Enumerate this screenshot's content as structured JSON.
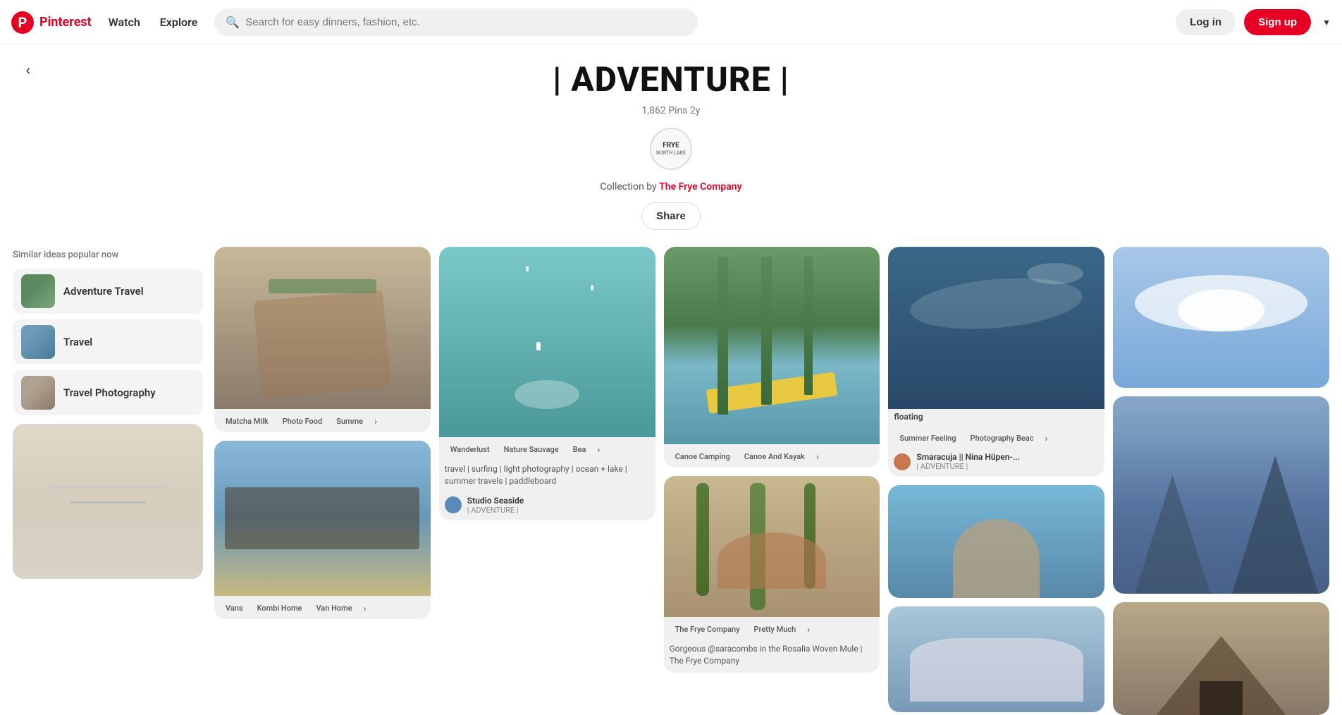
{
  "header": {
    "logo_text": "Pinterest",
    "nav": [
      {
        "id": "watch",
        "label": "Watch"
      },
      {
        "id": "explore",
        "label": "Explore"
      }
    ],
    "search_placeholder": "Search for easy dinners, fashion, etc.",
    "login_label": "Log in",
    "signup_label": "Sign up"
  },
  "board": {
    "title": "| ADVENTURE |",
    "pins_count": "1,862 Pins",
    "age": "2y",
    "frye_line1": "FRYE",
    "frye_line2": "NORTH LAKE",
    "collection_prefix": "Collection by ",
    "collection_owner": "The Frye Company",
    "share_label": "Share"
  },
  "sidebar": {
    "heading": "Similar ideas popular now",
    "items": [
      {
        "id": "adventure-travel",
        "label": "Adventure Travel"
      },
      {
        "id": "travel",
        "label": "Travel"
      },
      {
        "id": "travel-photography",
        "label": "Travel Photography"
      }
    ]
  },
  "pins": [
    {
      "id": "pin-food",
      "bg": "pin-bg-food",
      "tags": [
        "Matcha Milk",
        "Photo Food",
        "Summe"
      ],
      "has_more": true
    },
    {
      "id": "pin-van",
      "bg": "pin-bg-van",
      "tags": [
        "Vans",
        "Kombi Home",
        "Van Home"
      ],
      "has_more": true
    },
    {
      "id": "pin-water",
      "bg": "pin-bg-water",
      "tags": [
        "Wanderlust",
        "Nature Sauvage",
        "Bea"
      ],
      "has_more": true,
      "desc": "travel | surfing | light photography | ocean + lake | summer travels | paddleboard",
      "user_name": "Studio Seaside",
      "user_caption": "| ADVENTURE |"
    },
    {
      "id": "pin-canoe",
      "bg": "pin-bg-forest",
      "tags": [
        "Canoe Camping",
        "Canoe And Kayak"
      ],
      "has_more": true
    },
    {
      "id": "pin-cactus",
      "bg": "pin-bg-cactus",
      "tags": [
        "The Frye Company",
        "Pretty Much"
      ],
      "has_more": true,
      "desc": "Gorgeous @saracombs in the Rosalia Woven Mule | The Frye Company"
    },
    {
      "id": "pin-sea",
      "bg": "pin-bg-sea",
      "tags": [
        "Summer Feeling",
        "Photography Beac"
      ],
      "has_more": true,
      "caption": "floating",
      "user_name": "Smaracuja || Nina Hüpen-...",
      "user_caption": "| ADVENTURE |"
    },
    {
      "id": "pin-picnic",
      "bg": "pin-bg-picnic",
      "tags": [],
      "tall": true
    },
    {
      "id": "pin-rock",
      "bg": "pin-bg-rock",
      "tags": [],
      "tall": false
    },
    {
      "id": "pin-glacier",
      "bg": "pin-bg-glacier",
      "tags": [],
      "tall": false
    },
    {
      "id": "pin-cloud",
      "bg": "pin-bg-cloud",
      "tags": [],
      "tall": false
    },
    {
      "id": "pin-mountain",
      "bg": "pin-bg-mountain",
      "tags": [],
      "tall": true
    },
    {
      "id": "pin-tent",
      "bg": "pin-bg-tent",
      "tags": [],
      "tall": false
    }
  ]
}
